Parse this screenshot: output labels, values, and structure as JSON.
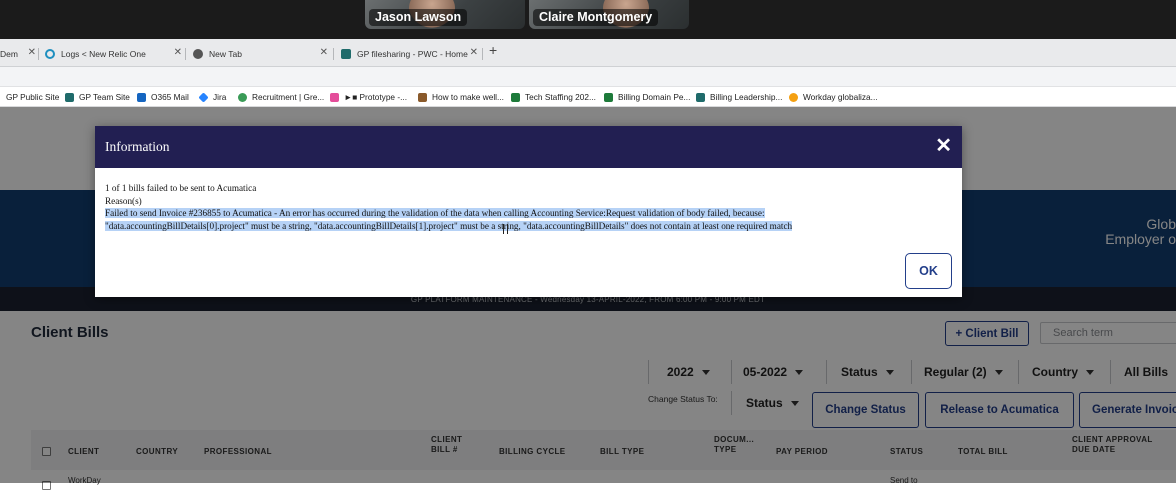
{
  "video_call": {
    "participants": [
      {
        "name": "Jason Lawson"
      },
      {
        "name": "Claire Montgomery"
      }
    ]
  },
  "browser": {
    "tabs": [
      {
        "label": "Dem",
        "active": false
      },
      {
        "label": "Logs < New Relic One",
        "active": false
      },
      {
        "label": "New Tab",
        "active": false
      },
      {
        "label": "GP filesharing - PWC - Home",
        "active": false
      }
    ],
    "new_tab_icon": "plus",
    "bookmarks": [
      {
        "label": "GP Public Site",
        "icon_color": "#1f4e8c"
      },
      {
        "label": "GP Team Site",
        "icon_color": "#1f6b6b"
      },
      {
        "label": "O365 Mail",
        "icon_color": "#1565c0"
      },
      {
        "label": "Jira",
        "icon_color": "#2684ff"
      },
      {
        "label": "Recruitment | Gre...",
        "icon_color": "#3a9b57"
      },
      {
        "label": "►■ Prototype -...",
        "icon_color": "#e44d9a"
      },
      {
        "label": "How to make well...",
        "icon_color": "#8a5a2b"
      },
      {
        "label": "Tech Staffing 202...",
        "icon_color": "#1d7a3a"
      },
      {
        "label": "Billing Domain Pe...",
        "icon_color": "#1d7a3a"
      },
      {
        "label": "Billing Leadership...",
        "icon_color": "#1f6b6b"
      },
      {
        "label": "Workday globaliza...",
        "icon_color": "#f4a012"
      }
    ]
  },
  "app": {
    "hero": {
      "line1": "Glob",
      "line2": "Employer o"
    },
    "maintenance_banner": "GP PLATFORM MAINTENANCE - Wednesday 13-APRIL-2022, FROM 6:00 PM - 9:00 PM EDT",
    "page_title": "Client Bills",
    "add_client_bill": "+ Client Bill",
    "search_placeholder": "Search term",
    "filters": {
      "year": "2022",
      "month": "05-2022",
      "status": "Status",
      "type": "Regular (2)",
      "country": "Country",
      "bills": "All Bills"
    },
    "change_status_label": "Change Status To:",
    "change_status_select": "Status",
    "buttons": {
      "change_status": "Change Status",
      "release": "Release to Acumatica",
      "generate": "Generate Invoic"
    },
    "table": {
      "columns": [
        "CLIENT",
        "COUNTRY",
        "PROFESSIONAL",
        "CLIENT\nBILL #",
        "BILLING CYCLE",
        "BILL TYPE",
        "DOCUM...\nTYPE",
        "PAY PERIOD",
        "STATUS",
        "TOTAL BILL",
        "CLIENT APPROVAL\nDUE DATE"
      ],
      "first_row": {
        "client": "WorkDay",
        "status": "Send to"
      }
    }
  },
  "modal": {
    "title": "Information",
    "close_icon": "close",
    "line1": "1 of 1 bills failed to be sent to Acumatica",
    "line2": "Reason(s)",
    "reason_line1": "Failed to send Invoice #236855 to Acumatica - An error has occurred during the validation of the data when calling Accounting Service:Request validation of body failed, because:",
    "reason_line2": "\"data.accountingBillDetails[0].project\" must be a string, \"data.accountingBillDetails[1].project\" must be a string, \"data.accountingBillDetails\" does not contain at least one required match",
    "ok_label": "OK"
  }
}
